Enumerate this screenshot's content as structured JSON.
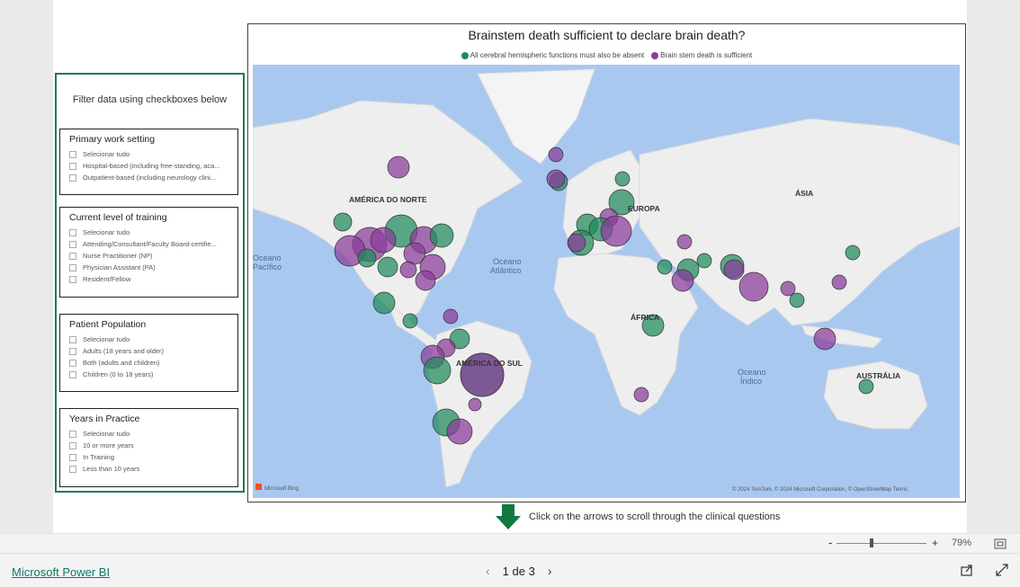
{
  "filters": {
    "header": "Filter data using checkboxes below",
    "slicers": [
      {
        "title": "Primary work setting",
        "options": [
          "Selecionar tudo",
          "Hospital-based (including free-standing, aca...",
          "Outpatient-based (including neurology clini..."
        ]
      },
      {
        "title": "Current level of training",
        "options": [
          "Selecionar tudo",
          "Attending/Consultant/Faculty Board-certifie...",
          "Nurse Practitioner (NP)",
          "Physician Assistant (PA)",
          "Resident/Fellow"
        ]
      },
      {
        "title": "Patient Population",
        "options": [
          "Selecionar tudo",
          "Adults (18 years and older)",
          "Both (adults and children)",
          "Children (0 to 18 years)"
        ]
      },
      {
        "title": "Years in Practice",
        "options": [
          "Selecionar tudo",
          "10 or more years",
          "In Training",
          "Less than 10 years"
        ]
      }
    ]
  },
  "map": {
    "title": "Brainstem death sufficient to declare brain death?",
    "legend": [
      {
        "label": "All cerebral hemispheric functions must also be absent",
        "color": "#1f8a5b"
      },
      {
        "label": "Brain stem death is sufficient",
        "color": "#8b3a9a"
      }
    ],
    "continents": [
      "AMÉRICA DO NORTE",
      "EUROPA",
      "ÁSIA",
      "ÁFRICA",
      "AMÉRICA DO SUL",
      "AUSTRÁLIA"
    ],
    "oceans": {
      "atlantic_1": "Oceano",
      "atlantic_2": "Atlântico",
      "indian_1": "Oceano",
      "indian_2": "Índico",
      "pacific_1": "Oceano",
      "pacific_2": "Pacífico"
    },
    "attribution": "© 2024 TomTom, © 2024 Microsoft Corporation, © OpenStreetMap  Terms",
    "bing": "Microsoft Bing"
  },
  "hint": "Click on the arrows to scroll through the clinical questions",
  "zoom": {
    "minus": "-",
    "plus": "+",
    "percent": "79%"
  },
  "footer": {
    "brand": "Microsoft Power BI",
    "page_label": "1 de 3"
  },
  "colors": {
    "accent": "#1f7a4c",
    "green": "#1f8a5b",
    "purple": "#8b3a9a",
    "water": "#a9c8f0",
    "land": "#eeeeee"
  }
}
